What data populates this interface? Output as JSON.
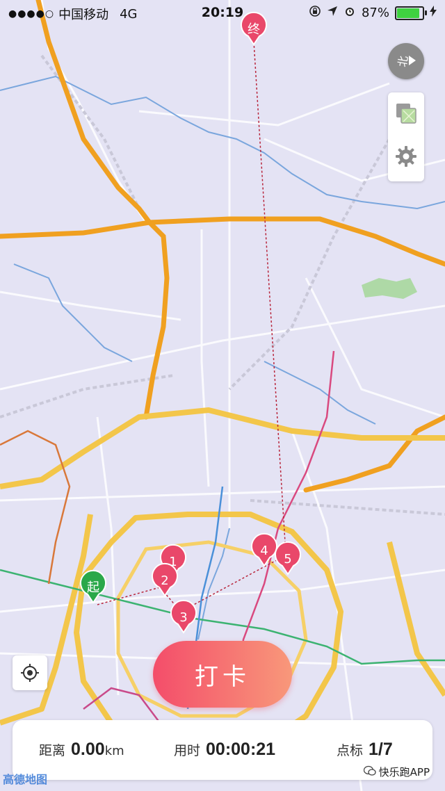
{
  "status_bar": {
    "carrier": "中国移动",
    "network": "4G",
    "time": "20:19",
    "battery": "87%",
    "battery_level": 0.87
  },
  "compass": {
    "label": "北"
  },
  "map": {
    "start_label": "起",
    "end_label": "终",
    "checkpoints": [
      "1",
      "2",
      "3",
      "4",
      "5"
    ],
    "brand": "高德地图"
  },
  "checkin_button": {
    "label": "打卡"
  },
  "stats": {
    "distance_label": "距离",
    "distance_value": "0.00",
    "distance_unit": "km",
    "time_label": "用时",
    "time_value": "00:00:21",
    "points_label": "点标",
    "points_value": "1/7"
  },
  "watermark": {
    "text": "快乐跑APP"
  },
  "colors": {
    "map_bg": "#e4e3f4",
    "highway": "#f0a020",
    "ring_road": "#f3c64a",
    "pin": "#e9486a",
    "start_pin": "#2aa84a",
    "checkin_gradient_start": "#f44d6a",
    "checkin_gradient_end": "#f8987a"
  }
}
